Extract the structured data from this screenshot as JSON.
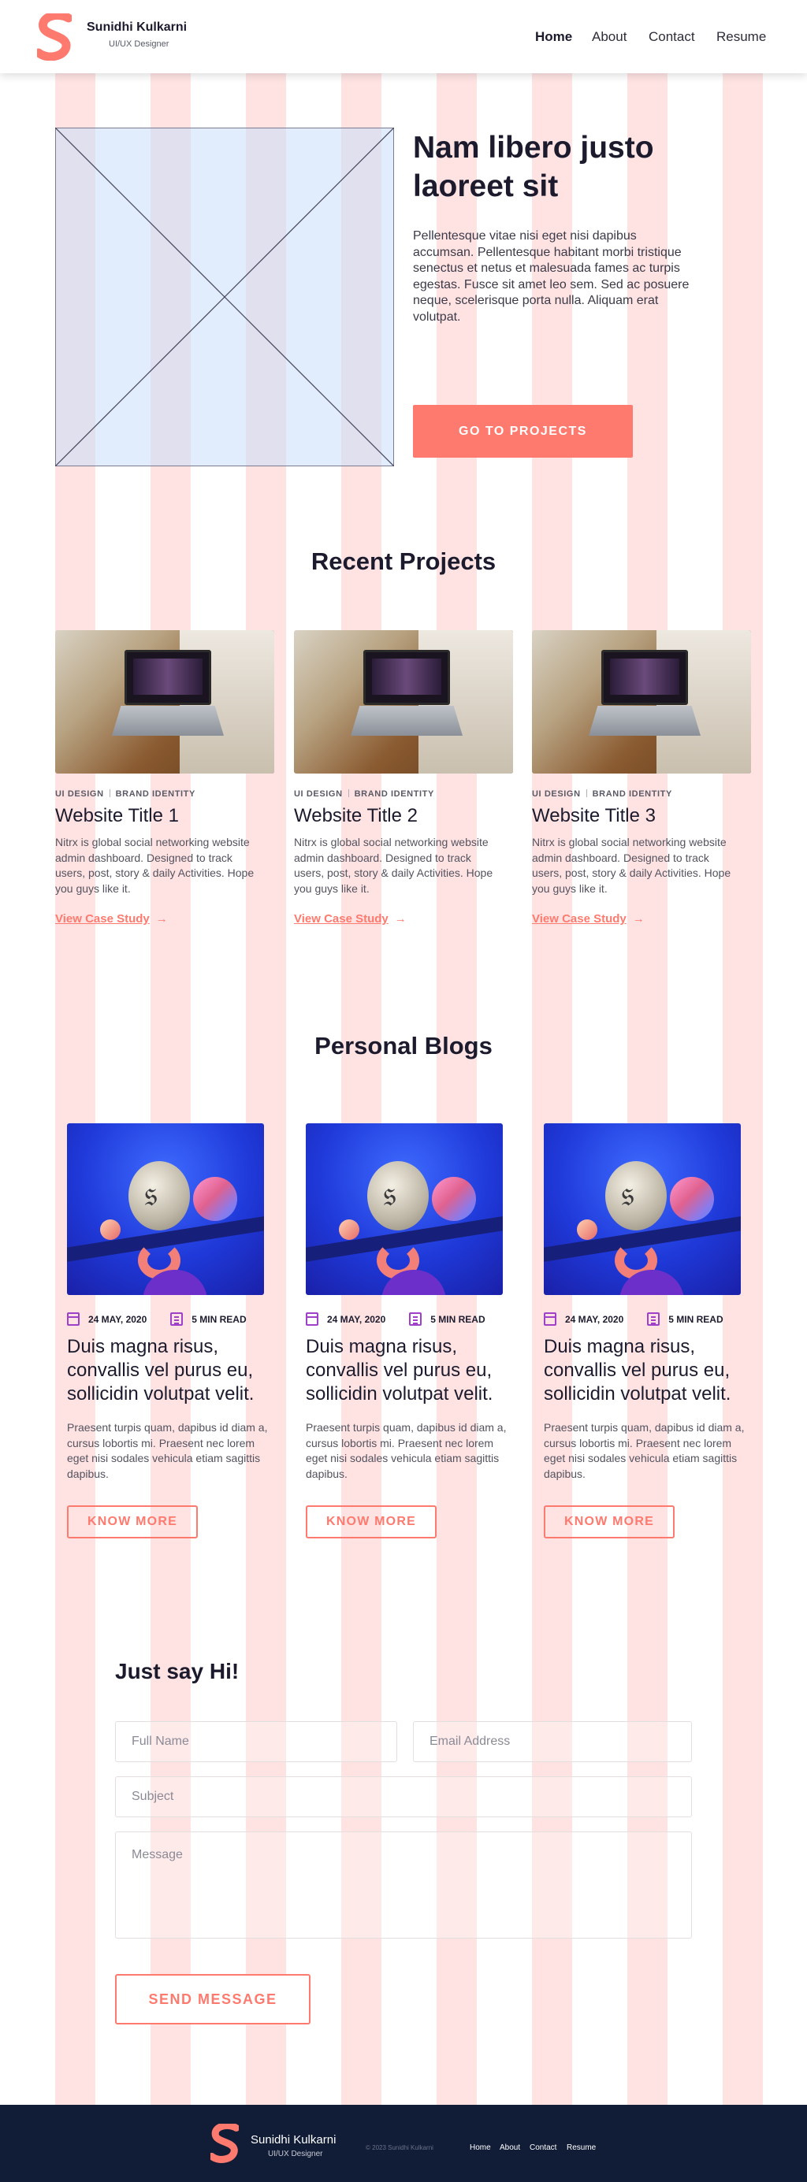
{
  "colors": {
    "accent": "#ff7a6e",
    "footer_bg": "#111c36",
    "text_dark": "#1c1b2e",
    "icon_purple": "#a040c8"
  },
  "brand": {
    "name": "Sunidhi Kulkarni",
    "role": "UI/UX Designer"
  },
  "nav": [
    {
      "label": "Home",
      "active": true
    },
    {
      "label": "About"
    },
    {
      "label": "Contact"
    },
    {
      "label": "Resume"
    }
  ],
  "hero": {
    "title": "Nam libero justo laoreet sit",
    "text": "Pellentesque vitae nisi eget nisi dapibus accumsan. Pellentesque habitant morbi tristique senectus et netus et malesuada fames ac turpis egestas. Fusce sit amet leo sem. Sed ac posuere neque, scelerisque porta nulla. Aliquam erat volutpat.",
    "cta": "GO TO PROJECTS",
    "image_icon": "image-placeholder-icon"
  },
  "projects": {
    "title": "Recent Projects",
    "items": [
      {
        "tag1": "UI DESIGN",
        "tag2": "BRAND IDENTITY",
        "title": "Website Title 1",
        "desc": "Nitrx is global social networking website admin dashboard. Designed to track users, post, story & daily Activities. Hope you guys like it.",
        "link": "View Case Study"
      },
      {
        "tag1": "UI DESIGN",
        "tag2": "BRAND IDENTITY",
        "title": "Website Title 2",
        "desc": "Nitrx is global social networking website admin dashboard. Designed to track users, post, story & daily Activities. Hope you guys like it.",
        "link": "View Case Study"
      },
      {
        "tag1": "UI DESIGN",
        "tag2": "BRAND IDENTITY",
        "title": "Website Title 3",
        "desc": "Nitrx is global social networking website admin dashboard. Designed to track users, post, story & daily Activities. Hope you guys like it.",
        "link": "View Case Study"
      }
    ]
  },
  "blogs": {
    "title": "Personal Blogs",
    "items": [
      {
        "date": "24 MAY, 2020",
        "read": "5 MIN READ",
        "title": "Duis magna risus, convallis vel purus eu, sollicidin volutpat velit.",
        "desc": "Praesent turpis quam, dapibus id diam a, cursus lobortis mi. Praesent nec lorem eget nisi sodales vehicula etiam sagittis dapibus.",
        "button": "KNOW MORE"
      },
      {
        "date": "24 MAY, 2020",
        "read": "5 MIN READ",
        "title": "Duis magna risus, convallis vel purus eu, sollicidin volutpat velit.",
        "desc": "Praesent turpis quam, dapibus id diam a, cursus lobortis mi. Praesent nec lorem eget nisi sodales vehicula etiam sagittis dapibus.",
        "button": "KNOW MORE"
      },
      {
        "date": "24 MAY, 2020",
        "read": "5 MIN READ",
        "title": "Duis magna risus, convallis vel purus eu, sollicidin volutpat velit.",
        "desc": "Praesent turpis quam, dapibus id diam a, cursus lobortis mi. Praesent nec lorem eget nisi sodales vehicula etiam sagittis dapibus.",
        "button": "KNOW MORE"
      }
    ]
  },
  "contact": {
    "title": "Just say Hi!",
    "full_name_placeholder": "Full Name",
    "email_placeholder": "Email Address",
    "subject_placeholder": "Subject",
    "message_placeholder": "Message",
    "send": "SEND MESSAGE"
  },
  "footer": {
    "name": "Sunidhi Kulkarni",
    "role": "UI/UX Designer",
    "copyright": "© 2023 Sunidhi Kulkarni",
    "nav": [
      "Home",
      "About",
      "Contact",
      "Resume"
    ]
  }
}
